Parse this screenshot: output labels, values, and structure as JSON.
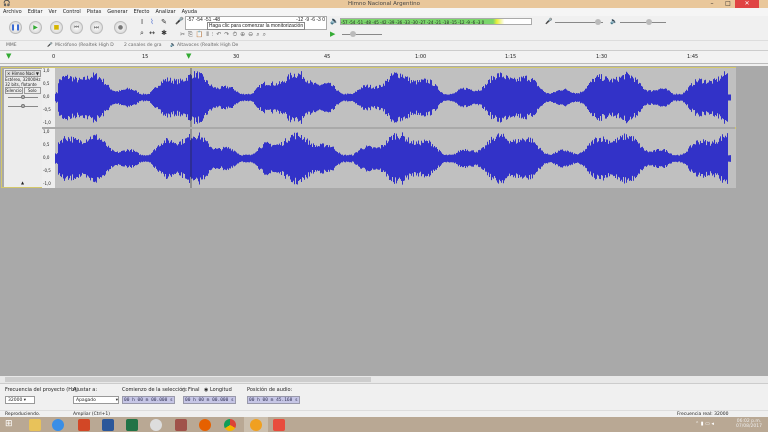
{
  "window": {
    "title": "Himno Nacional Argentino",
    "minimize": "–",
    "maximize": "□",
    "close": "✕",
    "close_color": "#e04343"
  },
  "menu": [
    "Archivo",
    "Editar",
    "Ver",
    "Control",
    "Pistas",
    "Generar",
    "Efecto",
    "Analizar",
    "Ayuda"
  ],
  "transport": {
    "pause": "❚❚",
    "play": "▶",
    "stop": "■",
    "skip_start": "⏮",
    "skip_end": "⏭",
    "record": "●"
  },
  "meters": {
    "record_scale": "-57 -54 -51 -48",
    "record_prompt": "Haga clic para comenzar la monitorización",
    "record_scale_end": "-12 -9 -6 -3 0",
    "play_scale": "-57 -54 -51 -48 -45 -42 -39 -36 -33 -30 -27 -24 -21 -18 -15 -12 -9 -6 -3 0",
    "play_level_color": "#7bd66b"
  },
  "devices": {
    "host": "MME",
    "mic": "Micrófono (Realtek High D",
    "channels": "2 canales de gra",
    "speaker": "Altavoces (Realtek High De"
  },
  "ruler": {
    "ticks": [
      "0",
      "15",
      "30",
      "45",
      "1:00",
      "1:15",
      "1:30",
      "1:45"
    ]
  },
  "track": {
    "name": "Himno Naci",
    "info1": "Estéreo, 32000Hz",
    "info2": "32 bits, flotante",
    "mute": "Silencio",
    "solo": "Solo",
    "scale": [
      "1,0",
      "0,5",
      "0,0",
      "-0,5",
      "-1,0"
    ],
    "wave_color": "#3232c8",
    "playback_position": "0:45.168"
  },
  "selection": {
    "rate_label": "Frecuencia del proyecto (Hz):",
    "rate": "32000",
    "snap_label": "Ajustar a:",
    "snap": "Apagado",
    "start_label": "Comienzo de la selección:",
    "end_opt": "Final",
    "length_opt": "Longitud",
    "length_selected": true,
    "start": "00 h 00 m 00.000 s",
    "length": "00 h 00 m 00.000 s",
    "pos_label": "Posición de audio:",
    "pos": "00 h 00 m 45.168 s"
  },
  "status": {
    "left": "Reproduciendo.",
    "zoom": "Ampliar (Ctrl+1)",
    "rate": "Frecuencia real: 32000"
  },
  "taskbar": {
    "time": "06:02 p.m.",
    "date": "07/08/2017",
    "apps": [
      "file-explorer",
      "internet-explorer",
      "powerpoint",
      "word",
      "excel",
      "clock-app",
      "app",
      "firefox",
      "chrome",
      "audacity",
      "app-red"
    ]
  }
}
